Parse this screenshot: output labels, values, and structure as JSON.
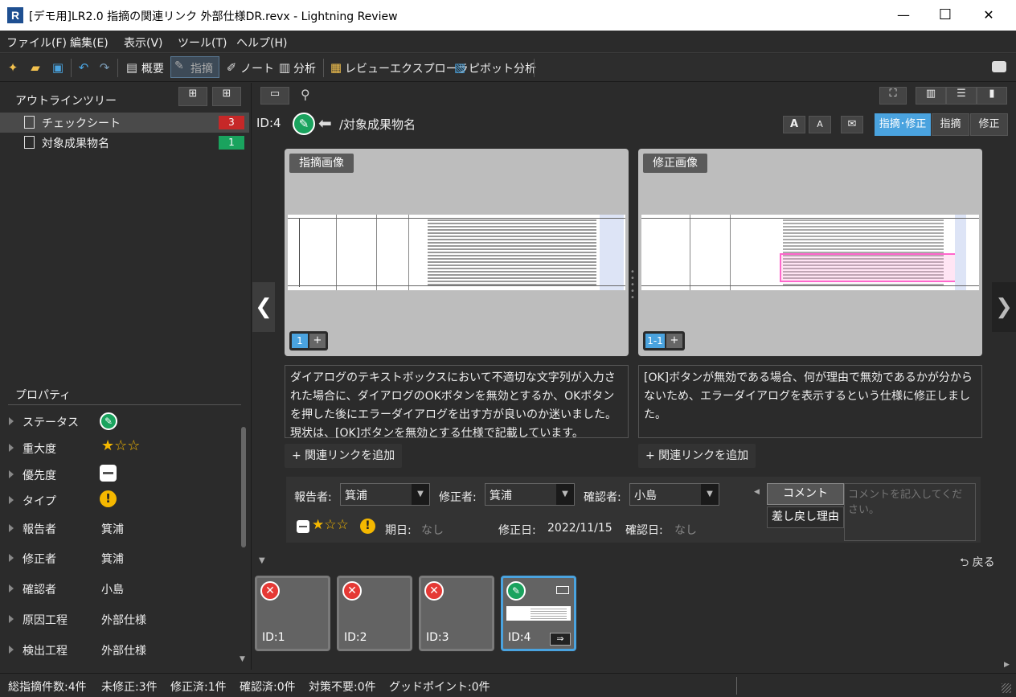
{
  "window": {
    "icon_letter": "R",
    "title": "[デモ用]LR2.0 指摘の関連リンク 外部仕様DR.revx  - Lightning Review",
    "minimize": "—",
    "maximize": "☐",
    "close": "✕"
  },
  "menu": [
    "ファイル(F)",
    "編集(E)",
    "表示(V)",
    "ツール(T)",
    "ヘルプ(H)"
  ],
  "toolbar": {
    "overview": "概要",
    "indication": "指摘",
    "note": "ノート",
    "analysis": "分析",
    "review_explorer": "レビューエクスプローラ",
    "pivot": "ピボット分析"
  },
  "outline": {
    "title": "アウトラインツリー",
    "items": [
      {
        "label": "チェックシート",
        "count": "3",
        "color": "#c62828"
      },
      {
        "label": "対象成果物名",
        "count": "1",
        "color": "#1aa35e"
      }
    ]
  },
  "properties": {
    "title": "プロパティ",
    "items": [
      {
        "label": "ステータス",
        "value": ""
      },
      {
        "label": "重大度",
        "value": "★☆☆"
      },
      {
        "label": "優先度",
        "value": ""
      },
      {
        "label": "タイプ",
        "value": ""
      },
      {
        "label": "報告者",
        "value": "箕浦"
      },
      {
        "label": "修正者",
        "value": "箕浦"
      },
      {
        "label": "確認者",
        "value": "小島"
      },
      {
        "label": "原因工程",
        "value": "外部仕様"
      },
      {
        "label": "検出工程",
        "value": "外部仕様"
      }
    ]
  },
  "issue": {
    "id": "ID:4",
    "path": "/対象成果物名",
    "modes": [
      "指摘･修正",
      "指摘",
      "修正"
    ],
    "font_up": "A",
    "font_down": "A",
    "left_image_label": "指摘画像",
    "right_image_label": "修正画像",
    "left_page": "1",
    "right_page": "1-1",
    "plus": "+",
    "left_desc": "ダイアログのテキストボックスにおいて不適切な文字列が入力された場合に、ダイアログのOKボタンを無効とするか、OKボタンを押した後にエラーダイアログを出す方が良いのか迷いました。現状は、[OK]ボタンを無効とする仕様で記載しています。",
    "right_desc": "[OK]ボタンが無効である場合、何が理由で無効であるかが分からないため、エラーダイアログを表示するという仕様に修正しました。",
    "add_link": "+ 関連リンクを追加"
  },
  "fields": {
    "reporter_label": "報告者:",
    "reporter": "箕浦",
    "fixer_label": "修正者:",
    "fixer": "箕浦",
    "checker_label": "確認者:",
    "checker": "小島",
    "stars": "★☆☆",
    "due_label": "期日:",
    "due": "なし",
    "fixed_label": "修正日:",
    "fixed": "2022/11/15",
    "confirmed_label": "確認日:",
    "confirmed": "なし",
    "comment_tab": "コメント",
    "reject_tab": "差し戻し理由",
    "comment_placeholder": "コメントを記入してください。"
  },
  "cards": {
    "back": "戻る",
    "items": [
      "ID:1",
      "ID:2",
      "ID:3",
      "ID:4"
    ]
  },
  "status": {
    "total": "総指摘件数:4件",
    "unfixed": "未修正:3件",
    "fixed": "修正済:1件",
    "confirmed": "確認済:0件",
    "not_needed": "対策不要:0件",
    "good_point": "グッドポイント:0件"
  },
  "colors": {
    "accent": "#4aa3df",
    "status_green": "#1aa35e",
    "status_red": "#e53935",
    "warn": "#f5b800"
  }
}
